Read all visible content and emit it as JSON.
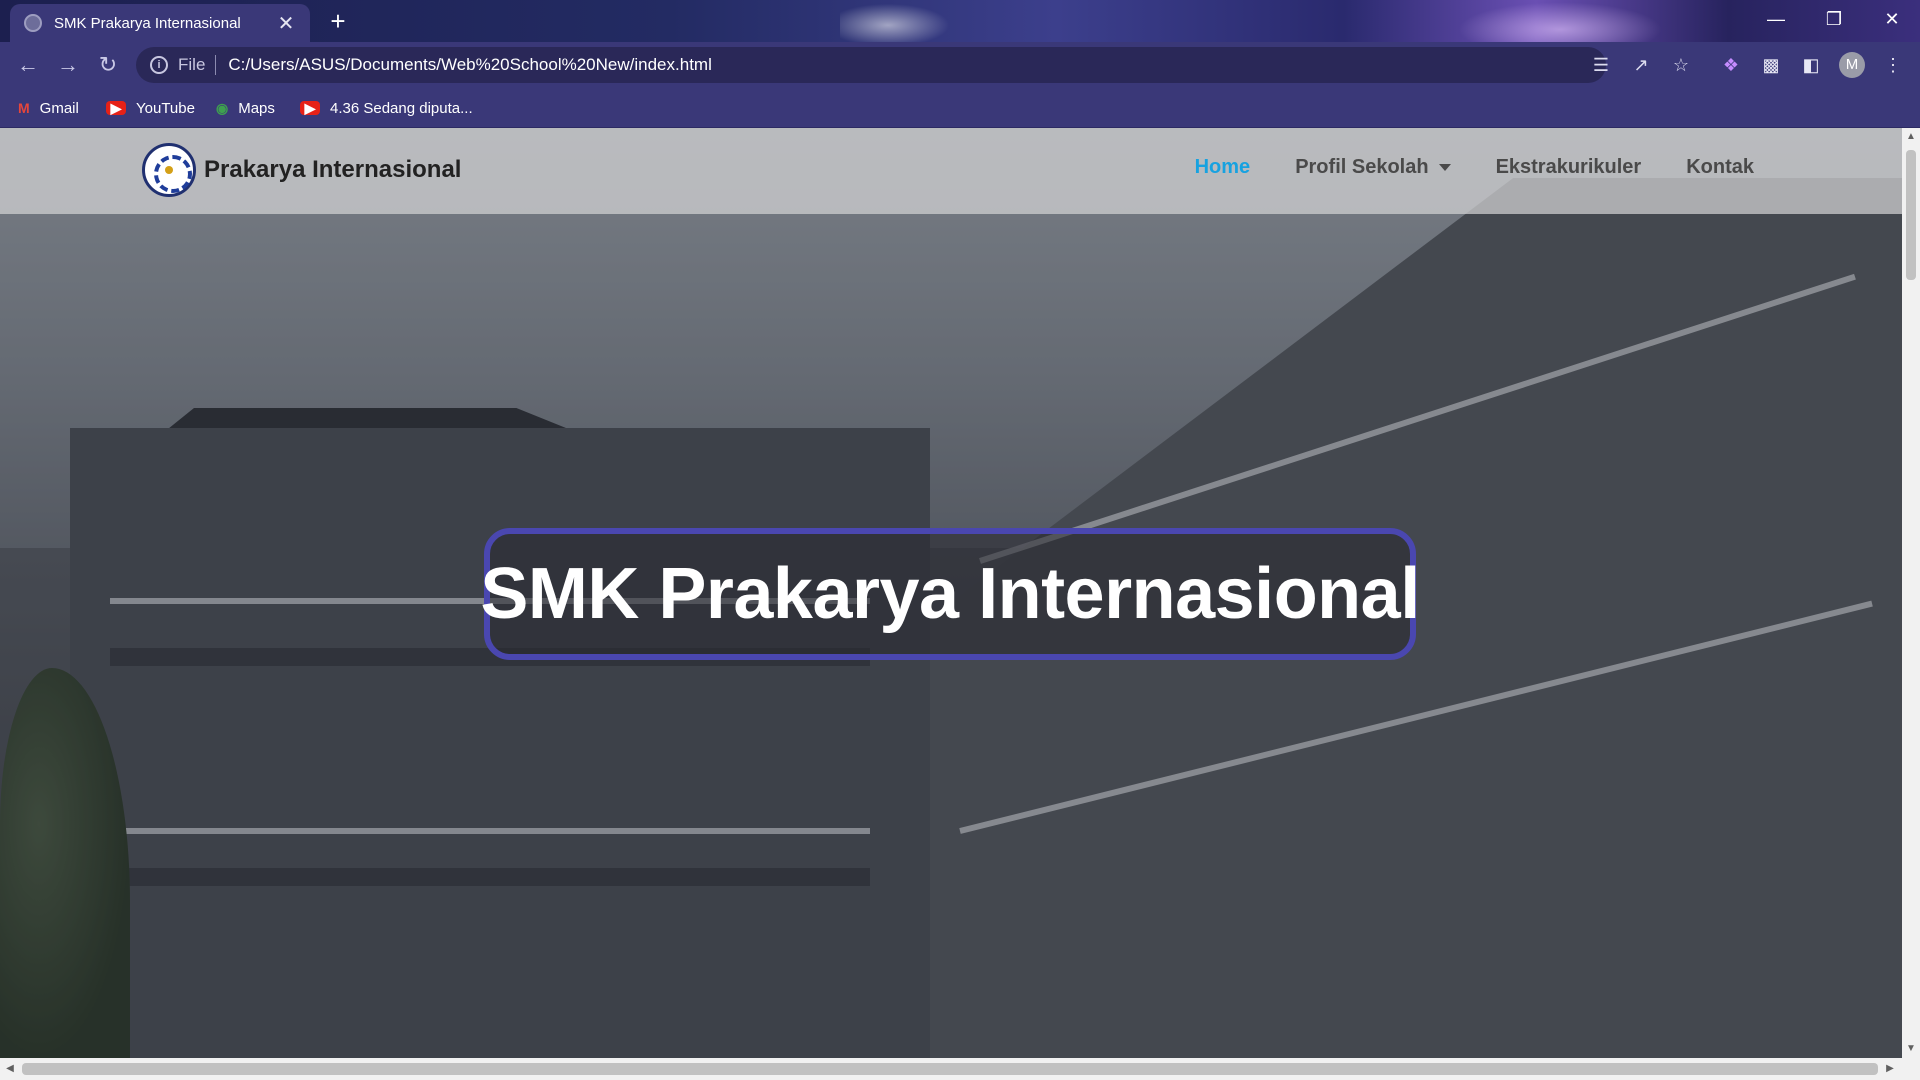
{
  "browser": {
    "tab_title": "SMK Prakarya Internasional",
    "tab_close": "✕",
    "new_tab": "+",
    "address_scheme": "File",
    "address_url": "C:/Users/ASUS/Documents/Web%20School%20New/index.html",
    "profile_initial": "M",
    "bookmarks": [
      {
        "label": "Gmail",
        "icon": "gmail-icon"
      },
      {
        "label": "YouTube",
        "icon": "youtube-icon"
      },
      {
        "label": "Maps",
        "icon": "maps-icon"
      },
      {
        "label": "4.36 Sedang diputa...",
        "icon": "youtube-icon"
      }
    ]
  },
  "site": {
    "brand": "Prakarya Internasional",
    "nav": [
      {
        "label": "Home",
        "active": true
      },
      {
        "label": "Profil Sekolah",
        "dropdown": true
      },
      {
        "label": "Ekstrakurikuler"
      },
      {
        "label": "Kontak"
      }
    ],
    "hero_title": "SMK Prakarya Internasional",
    "colors": {
      "active_link": "#17a2e0",
      "hero_border": "#4a47b0",
      "browser_frame": "#3a3878"
    }
  }
}
